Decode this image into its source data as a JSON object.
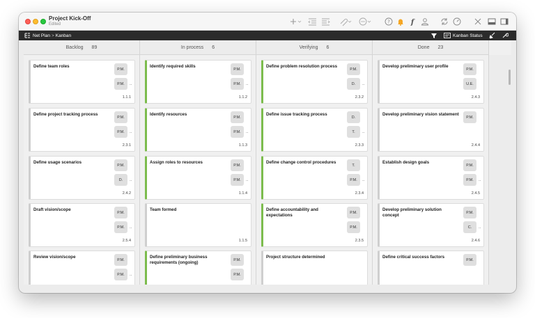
{
  "window": {
    "title": "Project Kick-Off",
    "subtitle": "Edited"
  },
  "pathbar": {
    "breadcrumb": [
      "Net Plan",
      "Kanban"
    ],
    "status_label": "Kanban Status"
  },
  "columns": [
    {
      "name": "Backlog",
      "count": "89",
      "cards": [
        {
          "title": "Define team roles",
          "badges": [
            "P.M.",
            "P.M."
          ],
          "more": true,
          "id": "1.1.1"
        },
        {
          "title": "Define project tracking process",
          "badges": [
            "P.M.",
            "P.M."
          ],
          "more": true,
          "id": "2.3.1"
        },
        {
          "title": "Define usage scenarios",
          "badges": [
            "P.M.",
            "D."
          ],
          "more": true,
          "id": "2.4.2"
        },
        {
          "title": "Draft vision/scope",
          "badges": [
            "P.M.",
            "P.M."
          ],
          "more": true,
          "id": "2.5.4"
        },
        {
          "title": "Review vision/scope",
          "badges": [
            "P.M.",
            "P.M."
          ],
          "more": true,
          "id": ""
        }
      ]
    },
    {
      "name": "In process",
      "count": "6",
      "cards": [
        {
          "title": "Identify required skills",
          "badges": [
            "P.M.",
            "P.M."
          ],
          "more": true,
          "id": "1.1.2",
          "green": true
        },
        {
          "title": "Identify resources",
          "badges": [
            "P.M.",
            "P.M."
          ],
          "more": true,
          "id": "1.1.3",
          "green": true
        },
        {
          "title": "Assign roles to resources",
          "badges": [
            "P.M.",
            "P.M."
          ],
          "more": true,
          "id": "1.1.4",
          "green": true
        },
        {
          "title": "Team formed",
          "badges": [],
          "more": false,
          "id": "1.1.5"
        },
        {
          "title": "Define preliminary business requirements (ongoing)",
          "badges": [
            "P.M.",
            "P.M."
          ],
          "more": false,
          "id": "",
          "green": true
        }
      ]
    },
    {
      "name": "Verifying",
      "count": "6",
      "cards": [
        {
          "title": "Define problem resolution process",
          "badges": [
            "P.M.",
            "D."
          ],
          "more": true,
          "id": "2.3.2",
          "green": true
        },
        {
          "title": "Define issue tracking process",
          "badges": [
            "D.",
            "T."
          ],
          "more": true,
          "id": "2.3.3",
          "green": true
        },
        {
          "title": "Define change control procedures",
          "badges": [
            "T.",
            "P.M."
          ],
          "more": true,
          "id": "2.3.4",
          "green": true
        },
        {
          "title": "Define accountability and expectations",
          "badges": [
            "P.M.",
            "P.M."
          ],
          "more": false,
          "id": "2.3.5",
          "green": true
        },
        {
          "title": "Project structure determined",
          "badges": [],
          "more": false,
          "id": ""
        }
      ]
    },
    {
      "name": "Done",
      "count": "23",
      "cards": [
        {
          "title": "Develop preliminary user profile",
          "badges": [
            "P.M.",
            "U.E."
          ],
          "more": false,
          "id": "2.4.3"
        },
        {
          "title": "Develop preliminary vision statement",
          "badges": [
            "P.M."
          ],
          "more": false,
          "id": "2.4.4"
        },
        {
          "title": "Establish design goals",
          "badges": [
            "P.M.",
            "P.M."
          ],
          "more": true,
          "id": "2.4.5"
        },
        {
          "title": "Develop preliminary solution concept",
          "badges": [
            "P.M.",
            "C."
          ],
          "more": true,
          "id": "2.4.6"
        },
        {
          "title": "Define critical success factors",
          "badges": [
            "P.M."
          ],
          "more": false,
          "id": ""
        }
      ]
    }
  ],
  "more_marker": "..",
  "colors": {
    "accent_green": "#7cbc4d",
    "pathbar_bg": "#2b2b2b",
    "bell": "#f5a623"
  },
  "icons": {
    "toolbar": [
      "plus-icon",
      "outdent-icon",
      "indent-icon",
      "link-icon",
      "more-icon",
      "help-icon",
      "bell-icon",
      "function-icon",
      "person-icon",
      "sync-icon",
      "gauge-icon",
      "tools-icon",
      "view-icon",
      "sidebar-icon"
    ],
    "pathbar": [
      "hierarchy-icon",
      "filter-icon",
      "kanban-status-icon",
      "broom-icon",
      "wrench-icon"
    ]
  }
}
